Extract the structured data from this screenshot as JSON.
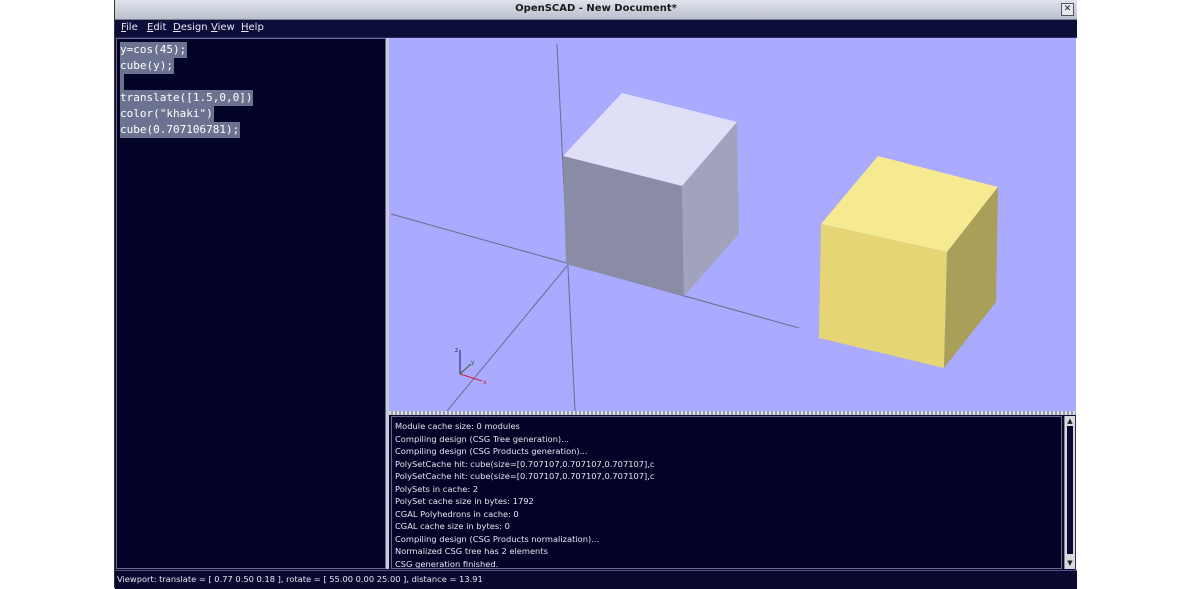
{
  "window": {
    "title": "OpenSCAD - New Document*",
    "close_icon": "close-icon"
  },
  "menu": {
    "items": [
      {
        "label": "File",
        "underline": "F",
        "rest": "ile"
      },
      {
        "label": "Edit",
        "underline": "E",
        "rest": "dit"
      },
      {
        "label": "Design",
        "underline": "D",
        "rest": "esign"
      },
      {
        "label": "View",
        "underline": "V",
        "rest": "iew"
      },
      {
        "label": "Help",
        "underline": "H",
        "rest": "elp"
      }
    ]
  },
  "editor": {
    "lines": [
      "y=cos(45);",
      "cube(y);",
      "",
      "translate([1.5,0,0])",
      "color(\"khaki\")",
      "cube(0.707106781);"
    ],
    "selection_color": "#6c7390"
  },
  "viewport": {
    "background": "#aaaaff",
    "axis_labels": {
      "z": "z",
      "y": "y",
      "x": "x"
    },
    "objects": [
      {
        "name": "white-cube",
        "top": "#dfe0f8",
        "front": "#8a8ca6",
        "side": "#a1a3bd"
      },
      {
        "name": "khaki-cube",
        "color_name": "khaki",
        "top": "#f6ea90",
        "front": "#e5d574",
        "side": "#a99f59"
      }
    ]
  },
  "console": {
    "lines": [
      "Module cache size: 0 modules",
      "Compiling design (CSG Tree generation)...",
      "Compiling design (CSG Products generation)...",
      "PolySetCache hit: cube(size=[0.707107,0.707107,0.707107],c",
      "PolySetCache hit: cube(size=[0.707107,0.707107,0.707107],c",
      "PolySets in cache: 2",
      "PolySet cache size in bytes: 1792",
      "CGAL Polyhedrons in cache: 0",
      "CGAL cache size in bytes: 0",
      "Compiling design (CSG Products normalization)...",
      "Normalized CSG tree has 2 elements",
      "CSG generation finished."
    ]
  },
  "status": {
    "text": "Viewport: translate = [ 0.77 0.50 0.18 ], rotate = [ 55.00 0.00 25.00 ], distance = 13.91"
  }
}
